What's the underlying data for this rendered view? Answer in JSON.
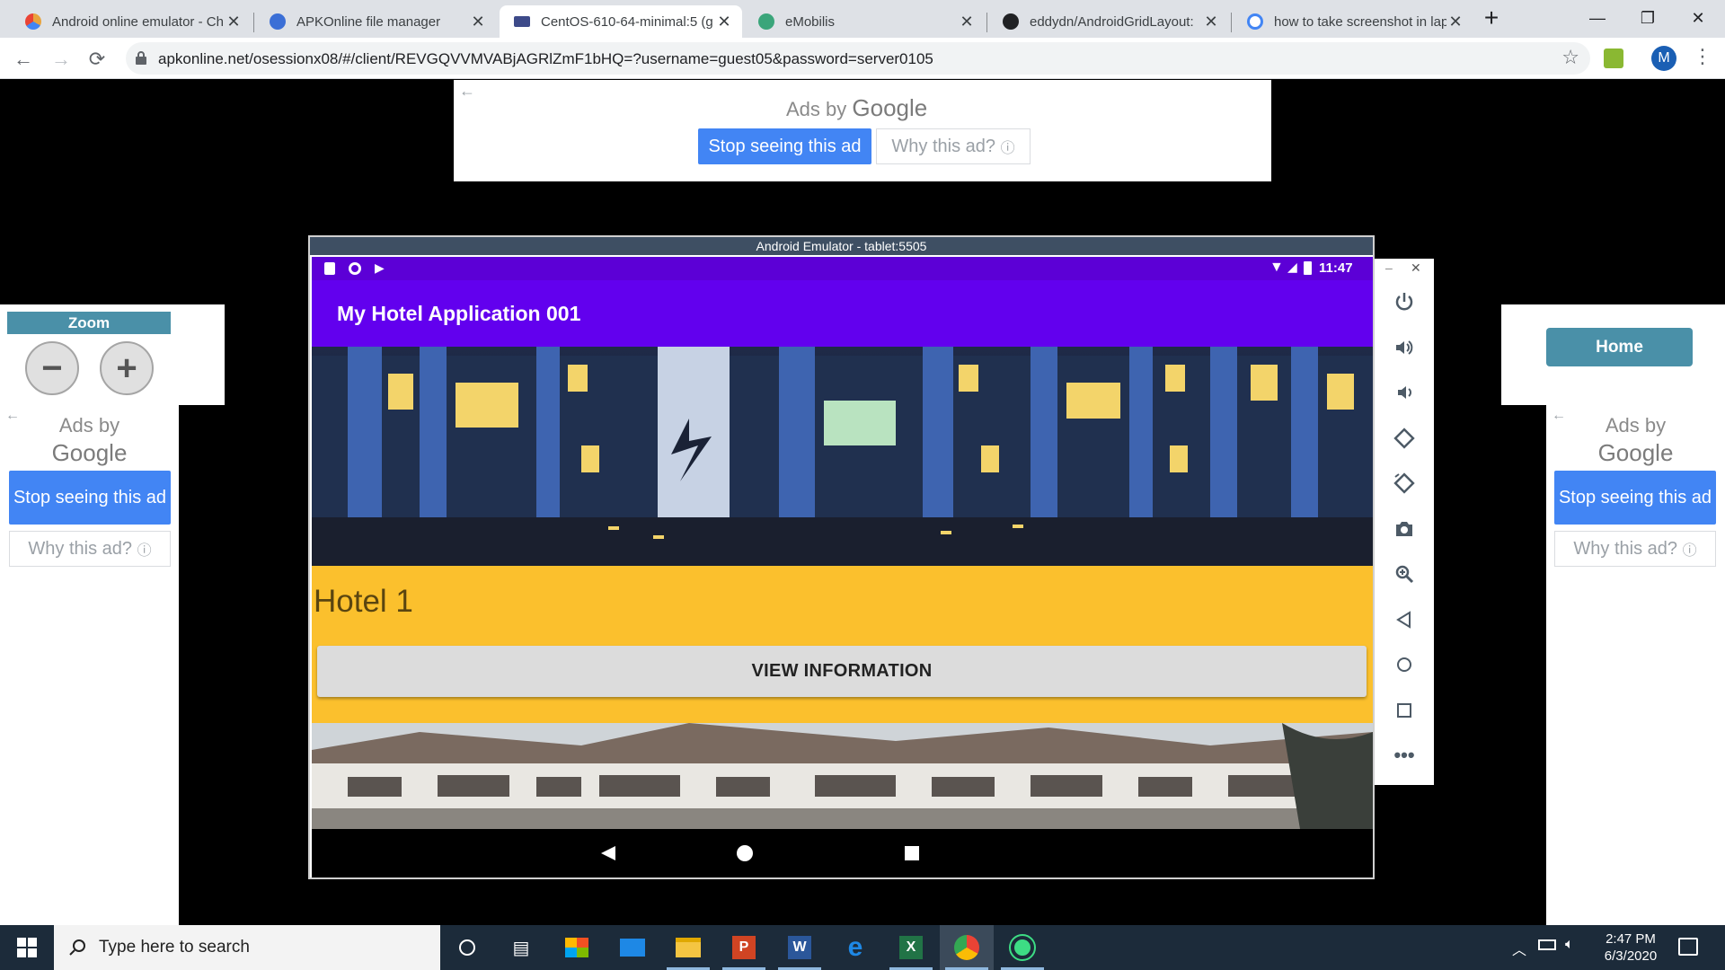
{
  "browser": {
    "tabs": [
      {
        "title": "Android online emulator - Ch",
        "favicon_color": "#e8a33d",
        "active": false
      },
      {
        "title": "APKOnline file manager",
        "favicon_color": "#3b6fd6",
        "active": false
      },
      {
        "title": "CentOS-610-64-minimal:5 (g",
        "favicon_color": "#3d4a89",
        "active": true
      },
      {
        "title": "eMobilis",
        "favicon_color": "#3aa57a",
        "active": false
      },
      {
        "title": "eddydn/AndroidGridLayout:",
        "favicon_color": "#202124",
        "active": false
      },
      {
        "title": "how to take screenshot in lap",
        "favicon_color": "#4285f4",
        "active": false
      }
    ],
    "new_tab_label": "+",
    "url": "apkonline.net/osessionx08/#/client/REVGQVVMVABjAGRlZmF1bHQ=?username=guest05&password=server0105",
    "profile_initial": "M"
  },
  "ads": {
    "ads_by": "Ads by",
    "google": "Google",
    "stop_label": "Stop seeing this ad",
    "why_label": "Why this ad?",
    "info_glyph": "ⓘ",
    "back_glyph": "←"
  },
  "zoom": {
    "title": "Zoom",
    "minus": "−",
    "plus": "+"
  },
  "emulator": {
    "window_title": "Android Emulator - tablet:5505",
    "status_time": "11:47",
    "app_title": "My Hotel Application 001",
    "hotel_name": "Hotel 1",
    "view_button": "VIEW INFORMATION",
    "accent_color": "#6200ee",
    "card_color": "#fbc02d"
  },
  "side_tools": [
    "power-icon",
    "volume-up-icon",
    "volume-down-icon",
    "rotate-left-icon",
    "rotate-right-icon",
    "camera-icon",
    "zoom-icon",
    "back-icon",
    "home-icon",
    "overview-icon",
    "more-icon"
  ],
  "home_panel": {
    "home_label": "Home"
  },
  "taskbar": {
    "search_placeholder": "Type here to search",
    "time": "2:47 PM",
    "date": "6/3/2020"
  }
}
